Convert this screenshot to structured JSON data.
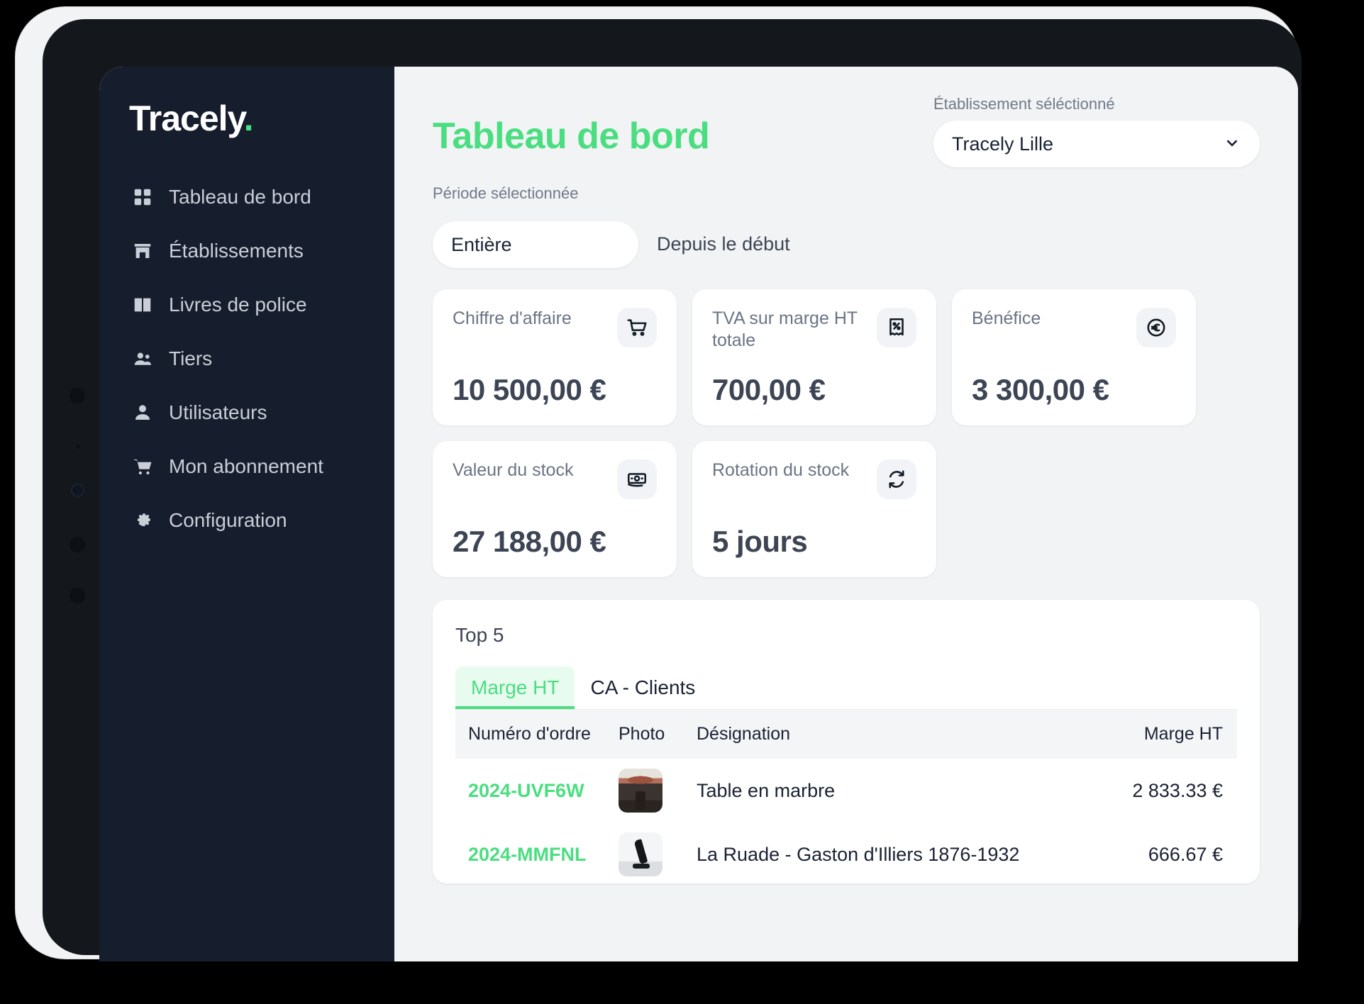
{
  "brand": {
    "name": "Tracely",
    "dot": "."
  },
  "sidebar": {
    "items": [
      {
        "label": "Tableau de bord",
        "icon": "grid-icon"
      },
      {
        "label": "Établissements",
        "icon": "store-icon"
      },
      {
        "label": "Livres de police",
        "icon": "book-icon"
      },
      {
        "label": "Tiers",
        "icon": "people-icon"
      },
      {
        "label": "Utilisateurs",
        "icon": "user-icon"
      },
      {
        "label": "Mon abonnement",
        "icon": "cart-icon"
      },
      {
        "label": "Configuration",
        "icon": "gear-icon"
      }
    ]
  },
  "header": {
    "title": "Tableau de bord",
    "establishment_label": "Établissement séléctionné",
    "establishment_value": "Tracely Lille",
    "period_label": "Période sélectionnée",
    "period_value": "Entière",
    "period_note": "Depuis le début"
  },
  "kpis": [
    {
      "label": "Chiffre d'affaire",
      "value": "10 500,00 €",
      "icon": "shopping-cart-icon"
    },
    {
      "label": "TVA sur marge HT totale",
      "value": "700,00 €",
      "icon": "receipt-percent-icon"
    },
    {
      "label": "Bénéfice",
      "value": "3 300,00 €",
      "icon": "euro-coin-icon"
    },
    {
      "label": "Valeur du stock",
      "value": "27 188,00 €",
      "icon": "banknote-icon"
    },
    {
      "label": "Rotation du stock",
      "value": "5 jours",
      "icon": "refresh-cycle-icon"
    }
  ],
  "top5": {
    "title": "Top 5",
    "tabs": [
      {
        "label": "Marge HT",
        "active": true
      },
      {
        "label": "CA - Clients",
        "active": false
      }
    ],
    "columns": {
      "num": "Numéro d'ordre",
      "photo": "Photo",
      "designation": "Désignation",
      "marge": "Marge HT"
    },
    "rows": [
      {
        "num": "2024-UVF6W",
        "designation": "Table en marbre",
        "marge": "2 833.33 €",
        "photo": "marble-table-thumbnail"
      },
      {
        "num": "2024-MMFNL",
        "designation": "La Ruade - Gaston d'Illiers 1876-1932",
        "marge": "666.67 €",
        "photo": "bronze-horse-thumbnail"
      }
    ]
  },
  "colors": {
    "accent_green": "#4ade80",
    "sidebar_bg": "#161d2c",
    "page_bg": "#f2f3f5",
    "value_text": "#3d4554"
  }
}
